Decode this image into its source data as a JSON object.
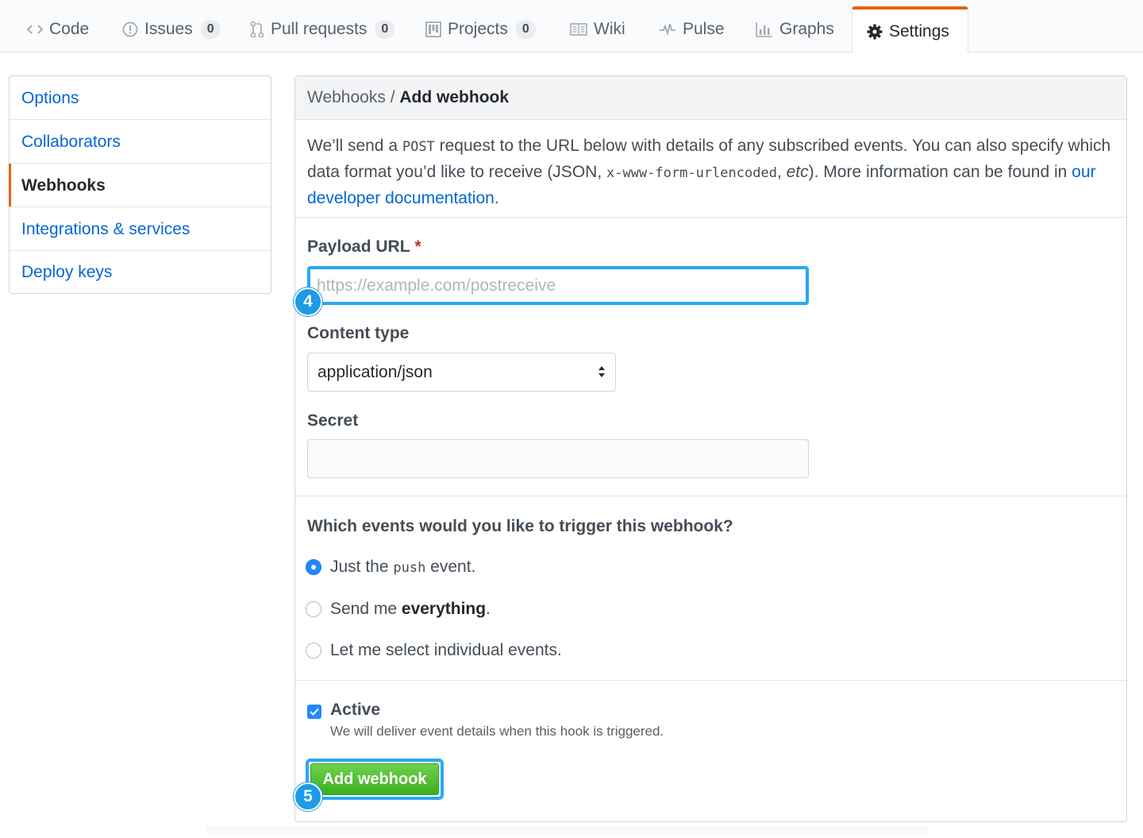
{
  "tabs": [
    {
      "label": "Code",
      "icon": "code-icon"
    },
    {
      "label": "Issues",
      "icon": "issue-icon",
      "count": "0"
    },
    {
      "label": "Pull requests",
      "icon": "pull-request-icon",
      "count": "0"
    },
    {
      "label": "Projects",
      "icon": "project-icon",
      "count": "0"
    },
    {
      "label": "Wiki",
      "icon": "book-icon"
    },
    {
      "label": "Pulse",
      "icon": "pulse-icon"
    },
    {
      "label": "Graphs",
      "icon": "graph-icon"
    },
    {
      "label": "Settings",
      "icon": "gear-icon",
      "selected": true
    }
  ],
  "sidebar": {
    "items": [
      {
        "label": "Options"
      },
      {
        "label": "Collaborators"
      },
      {
        "label": "Webhooks",
        "selected": true
      },
      {
        "label": "Integrations & services"
      },
      {
        "label": "Deploy keys"
      }
    ]
  },
  "header": {
    "breadcrumb_parent": "Webhooks",
    "separator": "/",
    "title": "Add webhook"
  },
  "intro": {
    "text1": "We’ll send a ",
    "code1": "POST",
    "text2": " request to the URL below with details of any subscribed events. You can also specify which data format you’d like to receive (JSON, ",
    "code2": "x-www-form-urlencoded",
    "text3": ", ",
    "etc": "etc",
    "text4": "). More information can be found in ",
    "link": "our developer documentation",
    "text5": "."
  },
  "form": {
    "payload_label": "Payload URL",
    "required_mark": "*",
    "payload_placeholder": "https://example.com/postreceive",
    "payload_value": "",
    "content_type_label": "Content type",
    "content_type_value": "application/json",
    "secret_label": "Secret",
    "secret_value": ""
  },
  "events": {
    "question": "Which events would you like to trigger this webhook?",
    "option1_pre": "Just the ",
    "option1_code": "push",
    "option1_post": " event.",
    "option2_pre": "Send me ",
    "option2_strong": "everything",
    "option2_post": ".",
    "option3": "Let me select individual events.",
    "selected": "option1"
  },
  "active": {
    "label": "Active",
    "checked": true,
    "note": "We will deliver event details when this hook is triggered."
  },
  "submit_label": "Add webhook",
  "callouts": {
    "payload": "4",
    "submit": "5"
  },
  "colors": {
    "link": "#0366d6",
    "tab_accent": "#e36209",
    "callout": "#1c9be6",
    "button_green": "#4cbf2a"
  }
}
